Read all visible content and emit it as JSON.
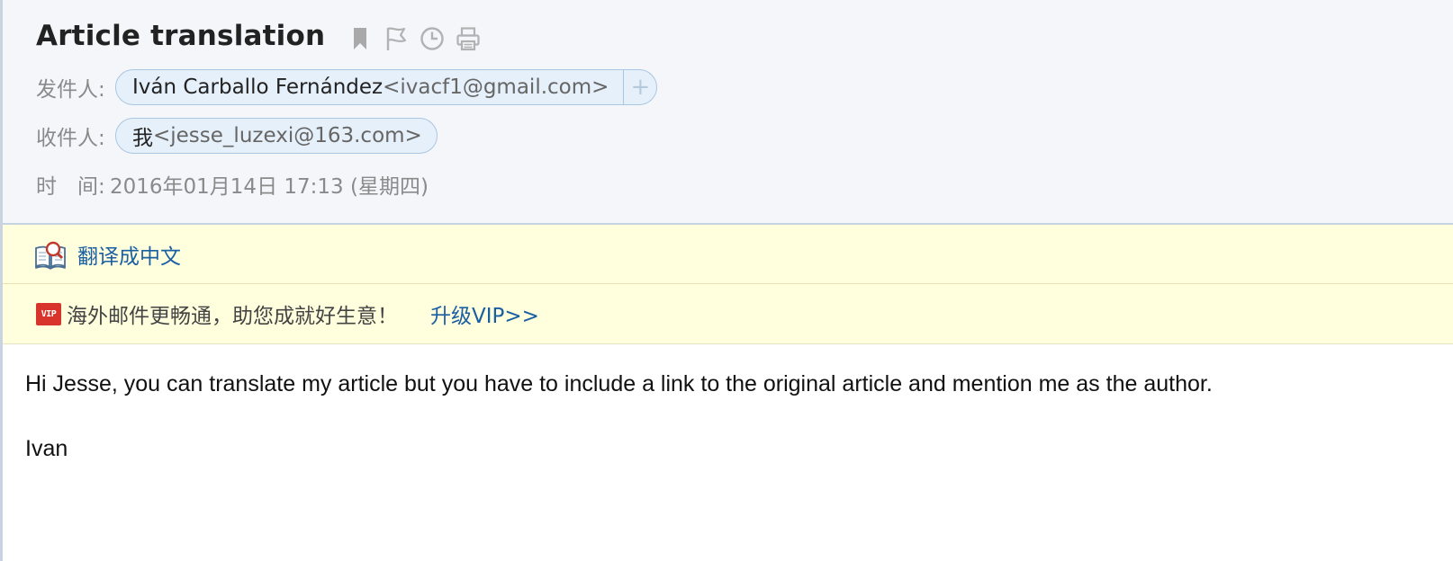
{
  "header": {
    "subject": "Article translation",
    "tools": [
      {
        "icon": "bookmark-icon"
      },
      {
        "icon": "flag-icon"
      },
      {
        "icon": "clock-icon"
      },
      {
        "icon": "print-icon"
      }
    ],
    "from": {
      "label": "发件人:",
      "name": "Iván Carballo Fernández",
      "address": "<ivacf1@gmail.com>",
      "add_label": "+"
    },
    "to": {
      "label": "收件人:",
      "name": "我",
      "address": "<jesse_luzexi@163.com>"
    },
    "time": {
      "label": "时　间:",
      "value": "2016年01月14日 17:13 (星期四)"
    }
  },
  "translate_bar": {
    "icon": "translate-book-icon",
    "link": "翻译成中文"
  },
  "vip_bar": {
    "badge": "VIP",
    "text": "海外邮件更畅通，助您成就好生意！",
    "link": "升级VIP>>",
    "badge_color": "#d9342b"
  },
  "body": {
    "paragraphs": [
      "Hi Jesse, you can translate my article but you have to include a link to the original article and mention me as the author.",
      "Ivan"
    ]
  },
  "colors": {
    "link": "#1b5fa3",
    "header_bg": "#f4f6fa",
    "notice_bg": "#ffffde",
    "pill_bg": "#e6f0fa"
  }
}
